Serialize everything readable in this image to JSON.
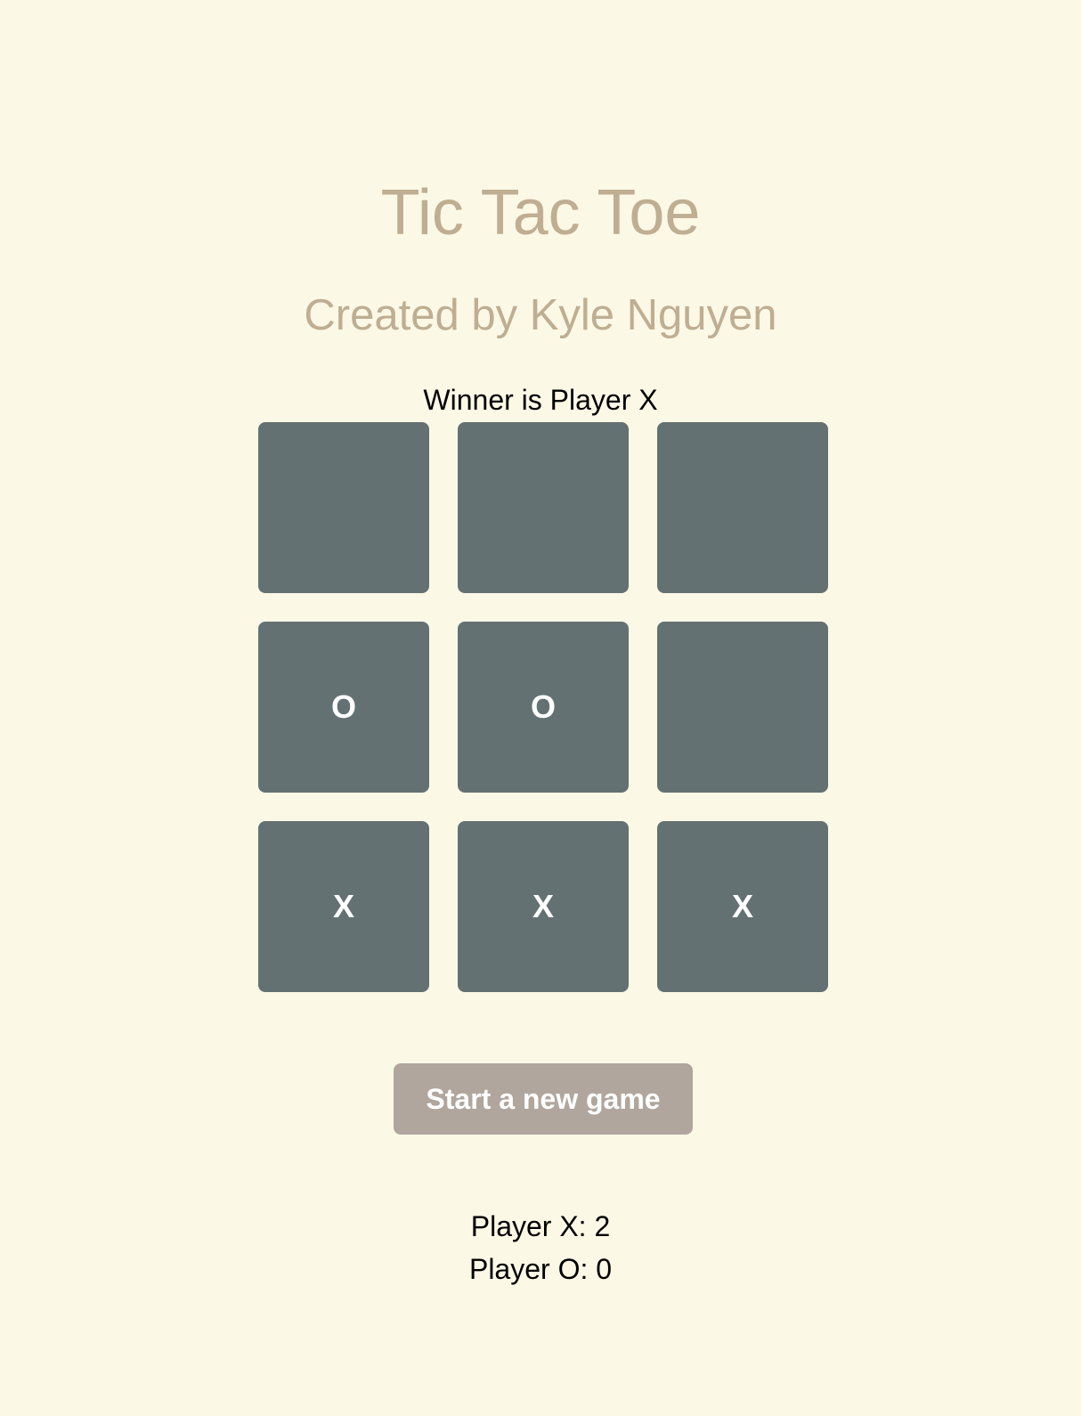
{
  "header": {
    "title": "Tic Tac Toe",
    "subtitle": "Created by Kyle Nguyen"
  },
  "status": "Winner is Player X",
  "board": [
    "",
    "",
    "",
    "O",
    "O",
    "",
    "X",
    "X",
    "X"
  ],
  "new_game_label": "Start a new game",
  "scores": {
    "x": "Player X: 2",
    "o": "Player O: 0"
  },
  "colors": {
    "background": "#fcf8e6",
    "cell": "#647172",
    "title": "#bfae91",
    "button": "#b0a69d"
  }
}
